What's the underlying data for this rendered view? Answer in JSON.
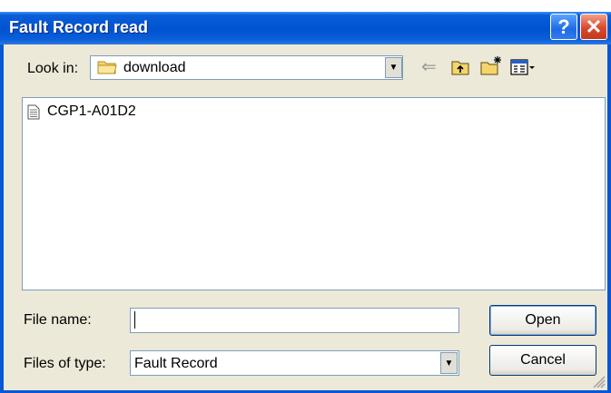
{
  "window": {
    "title": "Fault Record read",
    "help_label": "?",
    "close_label": "✕"
  },
  "look_in": {
    "label": "Look in:",
    "value": "download"
  },
  "toolbar": {
    "back_icon": "back-arrow-icon",
    "up_icon": "up-folder-icon",
    "new_folder_icon": "new-folder-icon",
    "view_menu_icon": "view-menu-icon"
  },
  "files": [
    {
      "name": "CGP1-A01D2"
    }
  ],
  "file_name": {
    "label": "File name:",
    "value": ""
  },
  "files_of_type": {
    "label": "Files of type:",
    "value": "Fault Record"
  },
  "buttons": {
    "open": "Open",
    "cancel": "Cancel"
  }
}
